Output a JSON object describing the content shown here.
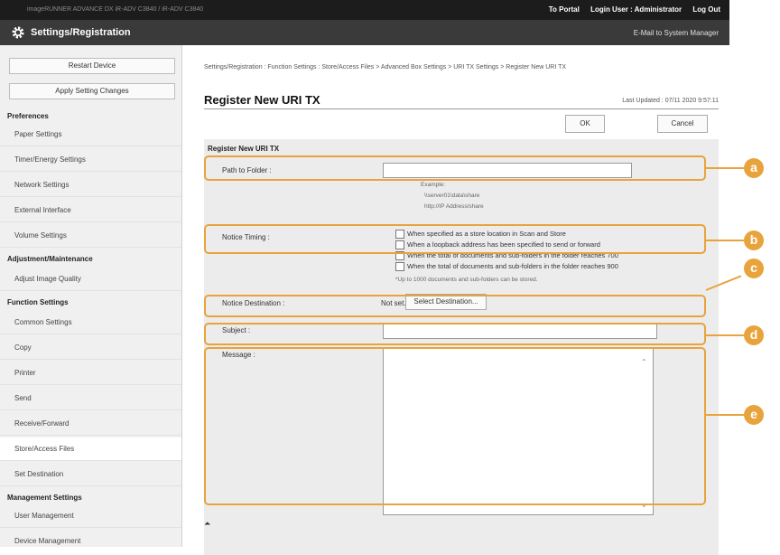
{
  "topbar": {
    "device": "imageRUNNER ADVANCE DX   iR-ADV C3840 / iR-ADV C3840",
    "to_portal": "To Portal",
    "login_user": "Login User : Administrator",
    "logout": "Log Out"
  },
  "header": {
    "title": "Settings/Registration",
    "mail": "E-Mail to System Manager"
  },
  "sidebar": {
    "restart": "Restart Device",
    "apply": "Apply Setting Changes",
    "sections": {
      "preferences": "Preferences",
      "adjustment": "Adjustment/Maintenance",
      "function": "Function Settings",
      "management": "Management Settings"
    },
    "items": [
      "Paper Settings",
      "Timer/Energy Settings",
      "Network Settings",
      "External Interface",
      "Volume Settings",
      "Adjust Image Quality",
      "Common Settings",
      "Copy",
      "Printer",
      "Send",
      "Receive/Forward",
      "Store/Access Files",
      "Set Destination",
      "User Management",
      "Device Management"
    ]
  },
  "main": {
    "breadcrumb": "Settings/Registration : Function Settings : Store/Access Files > Advanced Box Settings > URI TX Settings > Register New URI TX",
    "title": "Register New URI TX",
    "updated": "Last Updated : 07/11 2020 9:57:11",
    "ok": "OK",
    "cancel": "Cancel",
    "panel_header": "Register New URI TX",
    "path_label": "Path to Folder :",
    "path_value": "",
    "example_label": "Example:",
    "example_1": "\\\\server01\\data\\share",
    "example_2": "http://IP Address/share",
    "notice_timing_label": "Notice Timing :",
    "timing_options": [
      "When specified as a store location in Scan and Store",
      "When a loopback address has been specified to send or forward",
      "When the total of documents and sub-folders in the folder reaches 700",
      "When the total of documents and sub-folders in the folder reaches 900"
    ],
    "timing_note": "*Up to 1000 documents and sub-folders can be stored.",
    "notice_dest_label": "Notice Destination :",
    "not_set": "Not set.",
    "select_dest": "Select Destination...",
    "subject_label": "Subject :",
    "subject_value": "",
    "message_label": "Message :",
    "message_value": "",
    "top_arrow": "⏶"
  },
  "callouts": [
    "a",
    "b",
    "c",
    "d",
    "e"
  ],
  "colors": {
    "accent": "#e8a33c",
    "topbar": "#1c1c1c",
    "titlebar": "#3a3a3a"
  }
}
